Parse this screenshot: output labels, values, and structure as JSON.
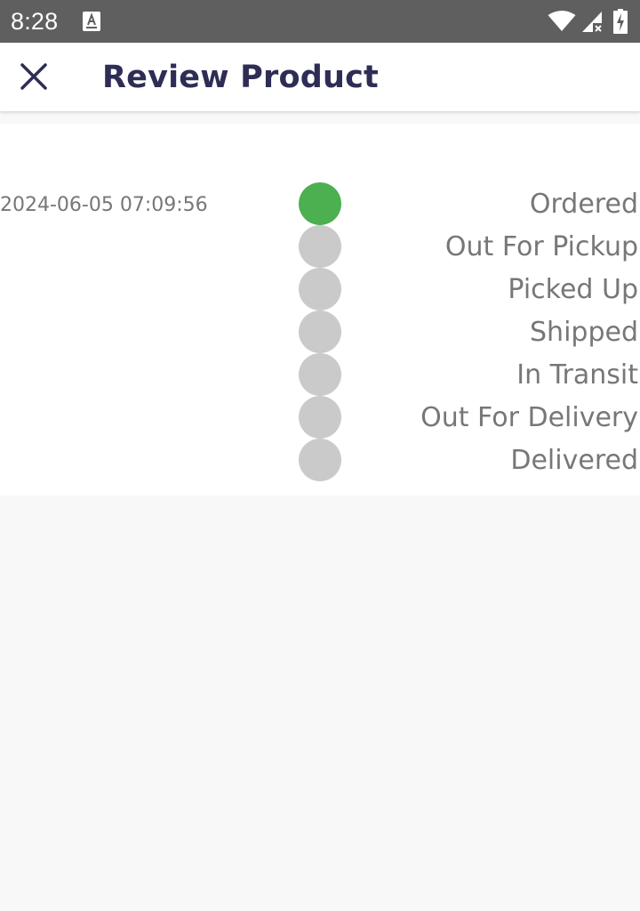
{
  "status_bar": {
    "time": "8:28"
  },
  "app_bar": {
    "title": "Review Product"
  },
  "tracking": {
    "timestamp": "2024-06-05 07:09:56",
    "steps": [
      {
        "label": "Ordered",
        "completed": true
      },
      {
        "label": "Out For Pickup",
        "completed": false
      },
      {
        "label": "Picked Up",
        "completed": false
      },
      {
        "label": "Shipped",
        "completed": false
      },
      {
        "label": "In Transit",
        "completed": false
      },
      {
        "label": "Out For Delivery",
        "completed": false
      },
      {
        "label": "Delivered",
        "completed": false
      }
    ]
  },
  "colors": {
    "completed_step": "#4caf50",
    "pending_step": "#cacaca",
    "title": "#2e2d55",
    "status_bar": "#5f5f5f"
  },
  "icons": {
    "close": "close-icon",
    "notification": "text-notification-icon",
    "wifi": "wifi-icon",
    "signal": "cell-signal-icon",
    "battery": "battery-charging-icon"
  }
}
